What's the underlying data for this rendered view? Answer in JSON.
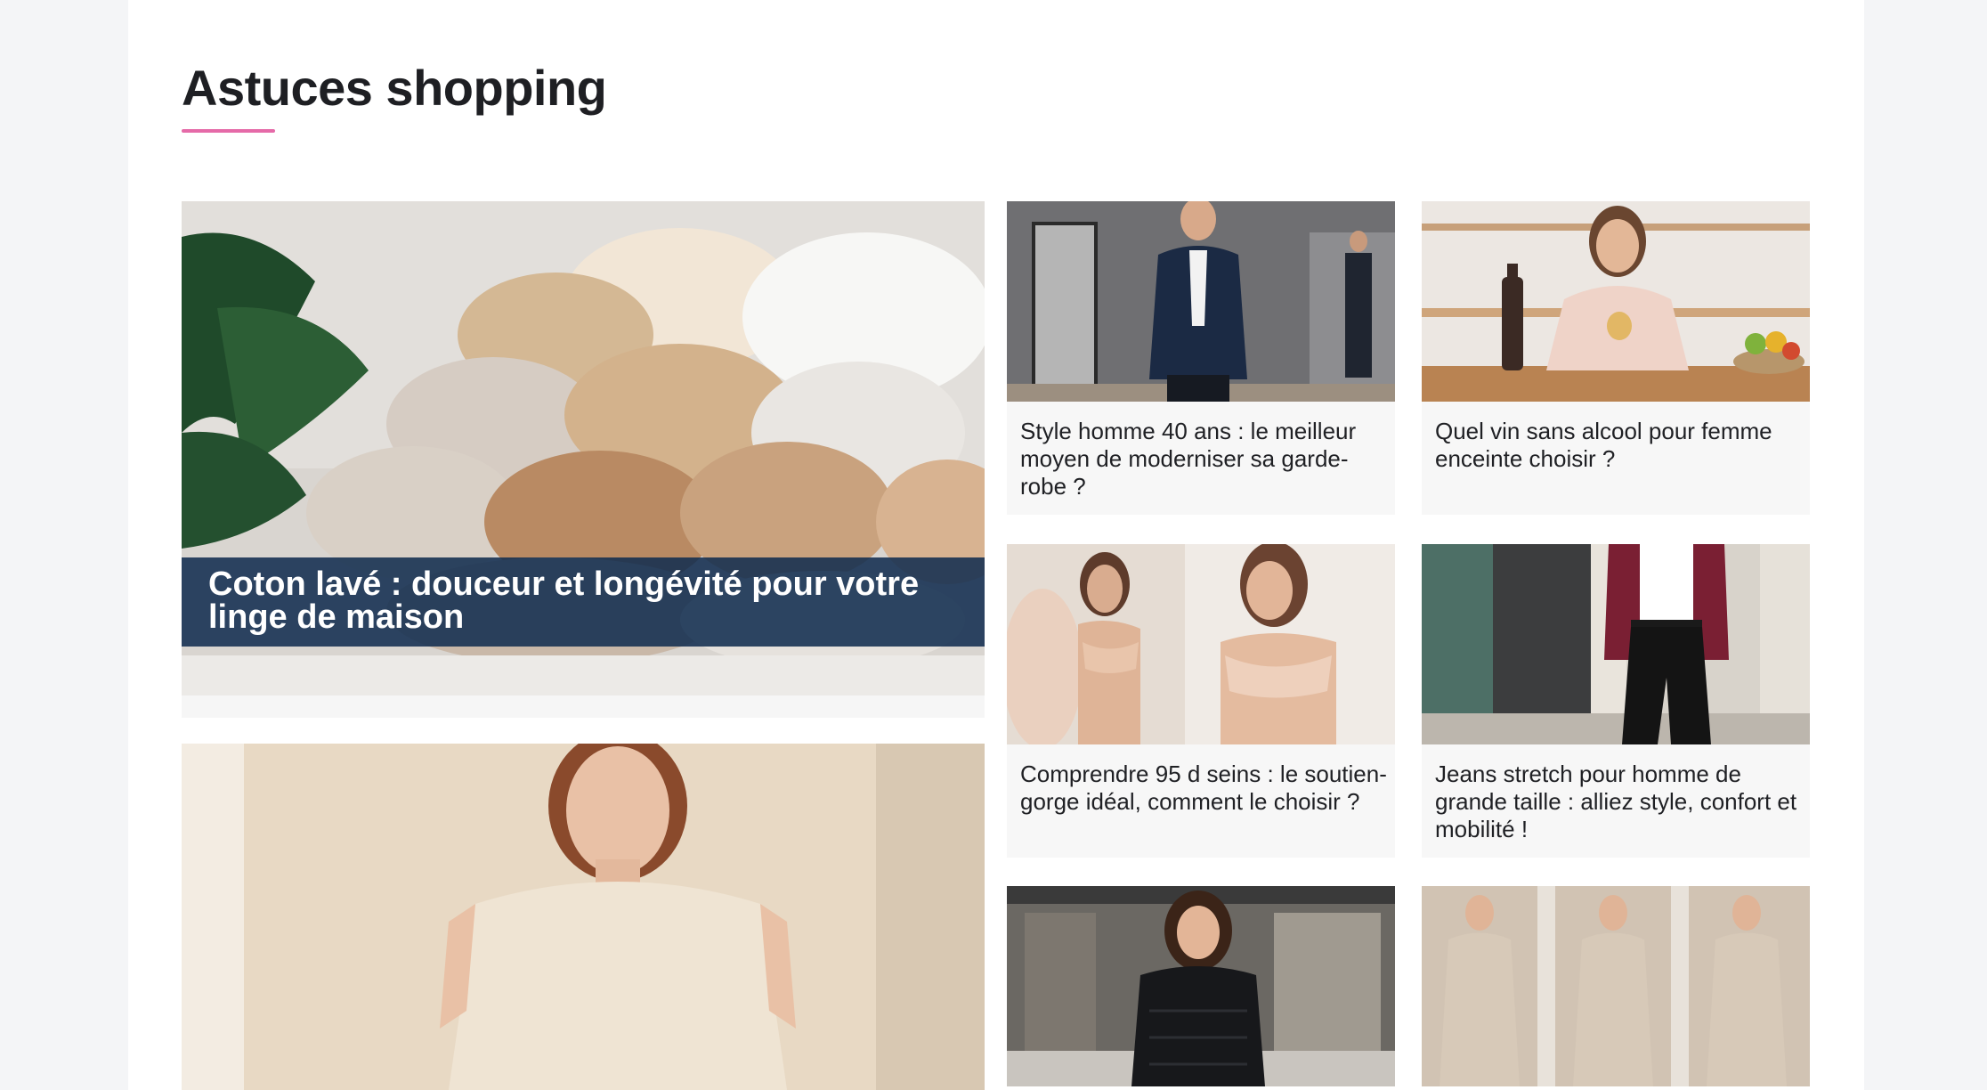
{
  "section": {
    "title": "Astuces shopping"
  },
  "colors": {
    "accent": "#e56aa8",
    "caption_bg": "#122d50"
  },
  "featured": {
    "title": "Coton lavé : douceur et longévité pour votre linge de maison",
    "image": "folded-cotton-linens-photo"
  },
  "featured_second": {
    "image": "woman-cream-dress-photo"
  },
  "articles": [
    {
      "title": "Style homme 40 ans : le meilleur moyen de moderniser sa garde-robe ?",
      "image": "man-navy-blazer-photo"
    },
    {
      "title": "Quel vin sans alcool pour femme enceinte choisir ?",
      "image": "pregnant-woman-wine-photo"
    },
    {
      "title": "Comprendre 95 d seins : le soutien-gorge idéal, comment le choisir ?",
      "image": "woman-bra-mirror-photo"
    },
    {
      "title": "Jeans stretch pour homme de grande taille : alliez style, confort et mobilité !",
      "image": "man-velvet-jacket-photo"
    },
    {
      "title": "",
      "image": "woman-black-puffer-jacket-photo"
    },
    {
      "title": "",
      "image": "women-wrap-dress-photo"
    }
  ]
}
